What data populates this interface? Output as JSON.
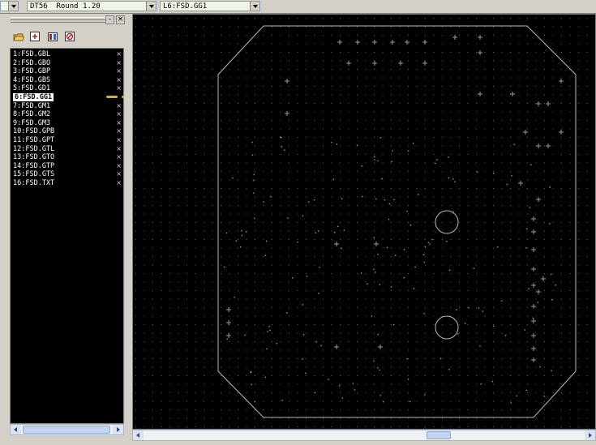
{
  "toolbar": {
    "tool_combo": {
      "text": "DT56  Round 1.20"
    },
    "layer_combo": {
      "text": "L6:FSD.GG1"
    }
  },
  "panel": {
    "close_label": "×",
    "minimize_label": "-",
    "tools": [
      {
        "icon": "open-folder-icon"
      },
      {
        "icon": "add-layer-icon"
      },
      {
        "icon": "layer-properties-icon"
      },
      {
        "icon": "delete-layer-icon"
      }
    ],
    "active_index": 5,
    "layers": [
      {
        "label": "1:FSD.GBL",
        "close": "×"
      },
      {
        "label": "2:FSD.GBO",
        "close": "×"
      },
      {
        "label": "3:FSD.GBP",
        "close": "×"
      },
      {
        "label": "4:FSD.GBS",
        "close": "×"
      },
      {
        "label": "5:FSD.GD1",
        "close": "×"
      },
      {
        "label": "6:FSD.GG1",
        "close": ""
      },
      {
        "label": "7:FSD.GM1",
        "close": "×"
      },
      {
        "label": "8:FSD.GM2",
        "close": "×"
      },
      {
        "label": "9:FSD.GM3",
        "close": "×"
      },
      {
        "label": "10:FSD.GPB",
        "close": "×"
      },
      {
        "label": "11:FSD.GPT",
        "close": "×"
      },
      {
        "label": "12:FSD.GTL",
        "close": "×"
      },
      {
        "label": "13:FSD.GTO",
        "close": "×"
      },
      {
        "label": "14:FSD.GTP",
        "close": "×"
      },
      {
        "label": "15:FSD.GTS",
        "close": "×"
      },
      {
        "label": "16:FSD.TXT",
        "close": "×"
      }
    ]
  },
  "colors": {
    "canvas_bg": "#000000",
    "grid_dot": "#5a6a5a",
    "outline": "#b8b8b8",
    "marks": "#9a9a9a",
    "active_marker": "#c9ae4f"
  }
}
